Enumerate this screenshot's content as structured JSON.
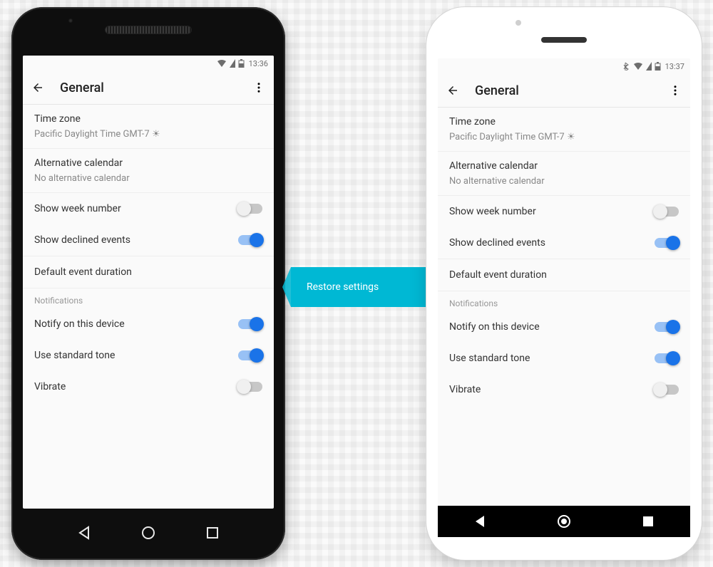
{
  "arrow_label": "Restore settings",
  "phoneA": {
    "statusbar": {
      "time": "13:36",
      "bluetooth": false
    },
    "appbar": {
      "title": "General"
    },
    "settings": {
      "timezone": {
        "label": "Time zone",
        "value": "Pacific Daylight Time  GMT-7",
        "sun": "☀"
      },
      "alt_calendar": {
        "label": "Alternative calendar",
        "value": "No alternative calendar"
      },
      "show_week_number": {
        "label": "Show week number",
        "on": false
      },
      "show_declined": {
        "label": "Show declined events",
        "on": true
      },
      "default_duration": {
        "label": "Default event duration"
      },
      "notifications_header": "Notifications",
      "notify_device": {
        "label": "Notify on this device",
        "on": true
      },
      "standard_tone": {
        "label": "Use standard tone",
        "on": true
      },
      "vibrate": {
        "label": "Vibrate",
        "on": false
      }
    }
  },
  "phoneB": {
    "statusbar": {
      "time": "13:37",
      "bluetooth": true
    },
    "appbar": {
      "title": "General"
    },
    "settings": {
      "timezone": {
        "label": "Time zone",
        "value": "Pacific Daylight Time  GMT-7",
        "sun": "☀"
      },
      "alt_calendar": {
        "label": "Alternative calendar",
        "value": "No alternative calendar"
      },
      "show_week_number": {
        "label": "Show week number",
        "on": false
      },
      "show_declined": {
        "label": "Show declined events",
        "on": true
      },
      "default_duration": {
        "label": "Default event duration"
      },
      "notifications_header": "Notifications",
      "notify_device": {
        "label": "Notify on this device",
        "on": true
      },
      "standard_tone": {
        "label": "Use standard tone",
        "on": true
      },
      "vibrate": {
        "label": "Vibrate",
        "on": false
      }
    }
  }
}
